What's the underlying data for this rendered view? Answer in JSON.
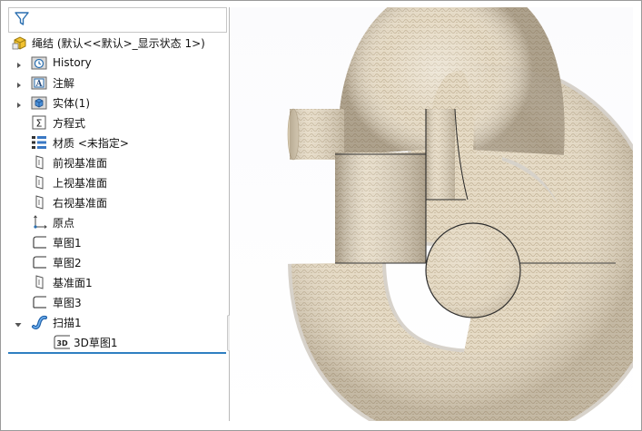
{
  "tree": {
    "root_label": "绳结 (默认<<默认>_显示状态 1>)",
    "items": [
      {
        "label": "History",
        "icon": "history-folder-icon",
        "expandable": true
      },
      {
        "label": "注解",
        "icon": "annotation-folder-icon",
        "expandable": true
      },
      {
        "label": "实体(1)",
        "icon": "solid-bodies-folder-icon",
        "expandable": true
      },
      {
        "label": "方程式",
        "icon": "equations-icon",
        "expandable": false
      },
      {
        "label": "材质 <未指定>",
        "icon": "material-icon",
        "expandable": false
      },
      {
        "label": "前视基准面",
        "icon": "plane-icon",
        "expandable": false
      },
      {
        "label": "上视基准面",
        "icon": "plane-icon",
        "expandable": false
      },
      {
        "label": "右视基准面",
        "icon": "plane-icon",
        "expandable": false
      },
      {
        "label": "原点",
        "icon": "origin-icon",
        "expandable": false
      },
      {
        "label": "草图1",
        "icon": "sketch-icon",
        "expandable": false
      },
      {
        "label": "草图2",
        "icon": "sketch-icon",
        "expandable": false
      },
      {
        "label": "基准面1",
        "icon": "plane-icon",
        "expandable": false
      },
      {
        "label": "草图3",
        "icon": "sketch-icon",
        "expandable": false
      },
      {
        "label": "扫描1",
        "icon": "sweep-feature-icon",
        "expandable": true
      },
      {
        "label": "3D草图1",
        "icon": "3d-sketch-icon",
        "expandable": false
      }
    ]
  },
  "badges": {
    "sketch3d": "3D"
  },
  "colors": {
    "accent": "#2f7fc1",
    "rope_base": "#e4d8c2",
    "rope_shadow": "#a89a84"
  }
}
